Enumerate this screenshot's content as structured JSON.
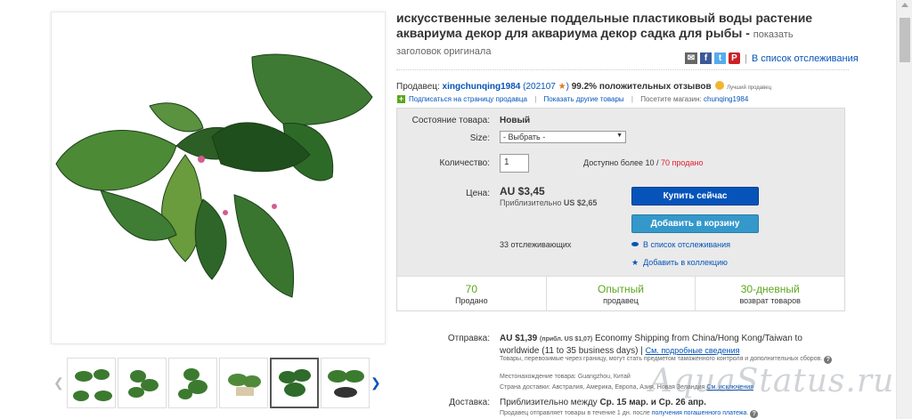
{
  "title": {
    "text": "искусственные зеленые поддельные пластиковый воды растение аквариума декор для аквариума декор садка для рыбы",
    "dash": "-",
    "original_link": "показать заголовок оригинала"
  },
  "share": {
    "icons": [
      "mail-icon",
      "facebook-icon",
      "twitter-icon",
      "pinterest-icon"
    ],
    "separator": "|",
    "watch": "В список отслеживания"
  },
  "seller": {
    "label": "Продавец:",
    "name": "xingchunqing1984",
    "feedback_open": "(",
    "feedback_count": "202107",
    "feedback_close": ")",
    "positive": "99.2% положительных отзывов",
    "top_text": "Лучший продавец",
    "subscribe": "Подписаться на страницу продавца",
    "sep": "|",
    "other_items": "Показать другие товары",
    "store_label": "Посетите магазин:",
    "store_name": "chunqing1984"
  },
  "buybox": {
    "condition_label": "Состояние товара:",
    "condition_value": "Новый",
    "size_label": "Size:",
    "size_value": "- Выбрать -",
    "qty_label": "Количество:",
    "qty_value": "1",
    "available": "Доступно более 10 /",
    "sold": "70 продано",
    "price_label": "Цена:",
    "price": "AU $3,45",
    "approx_label": "Приблизительно",
    "approx_value": "US $2,65",
    "buy_now": "Купить сейчас",
    "add_cart": "Добавить в корзину",
    "watchers": "33 отслеживающих",
    "add_watch": "В список отслеживания",
    "add_collection": "Добавить в коллекцию"
  },
  "stats": [
    {
      "big": "70",
      "small": "Продано"
    },
    {
      "big": "Опытный",
      "small": "продавец"
    },
    {
      "big": "30-дневный",
      "small": "возврат товаров"
    }
  ],
  "shipping": {
    "label": "Отправка:",
    "cost": "AU $1,39",
    "approx": "(прибл. US $1,07)",
    "method": "Economy Shipping from China/Hong Kong/Taiwan to worldwide (11 to 35 business days)",
    "sep": "|",
    "details": "См. подробные сведения",
    "note": "Товары, перевозимые через границу, могут стать предметом таможенного контроля и дополнительных сборов.",
    "location": "Местонахождение товара: Guangzhou, Китай",
    "countries": "Страна доставки: Австралия, Америка, Европа, Азия, Новая Зеландия",
    "countries_more": "См. исключения"
  },
  "delivery": {
    "label": "Доставка:",
    "text": "Приблизительно между",
    "dates": "Ср. 15 мар. и Ср. 26 апр.",
    "handling": "Продавец отправляет товары в течение 1 дн. после",
    "handling_link": "получения погашенного платежа",
    "handling_end": "."
  },
  "thumbs": {
    "count": 6,
    "active_index": 4
  },
  "watermark": "AquaStatus.ru",
  "colors": {
    "link": "#0654ba",
    "buy": "#0654ba",
    "cart": "#3498ca",
    "green": "#5ba71b",
    "sold_red": "#dd1e31"
  }
}
